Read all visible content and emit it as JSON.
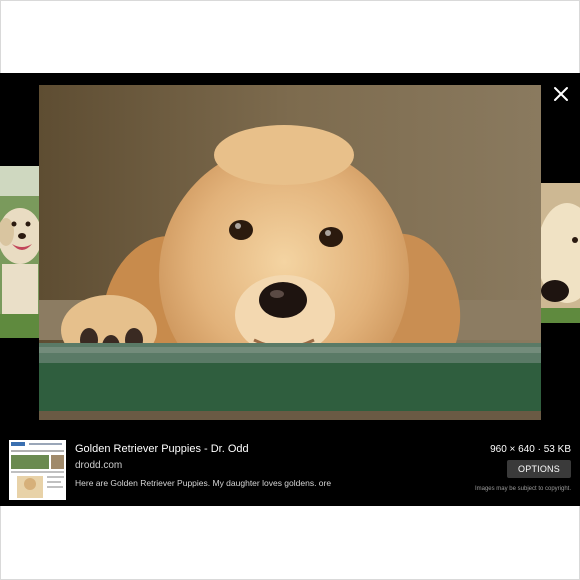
{
  "viewer": {
    "title": "Golden Retriever Puppies - Dr. Odd",
    "domain": "drodd.com",
    "description": "Here are Golden Retriever Puppies. My daughter loves goldens. ore",
    "dimensions": "960 × 640 · 53 KB",
    "options_label": "OPTIONS",
    "copyright_notice": "Images may be subject to copyright.",
    "close_icon": "close-icon"
  },
  "colors": {
    "viewer_background": "#000000",
    "page_background": "#ffffff",
    "options_button": "#3a3a3a"
  }
}
